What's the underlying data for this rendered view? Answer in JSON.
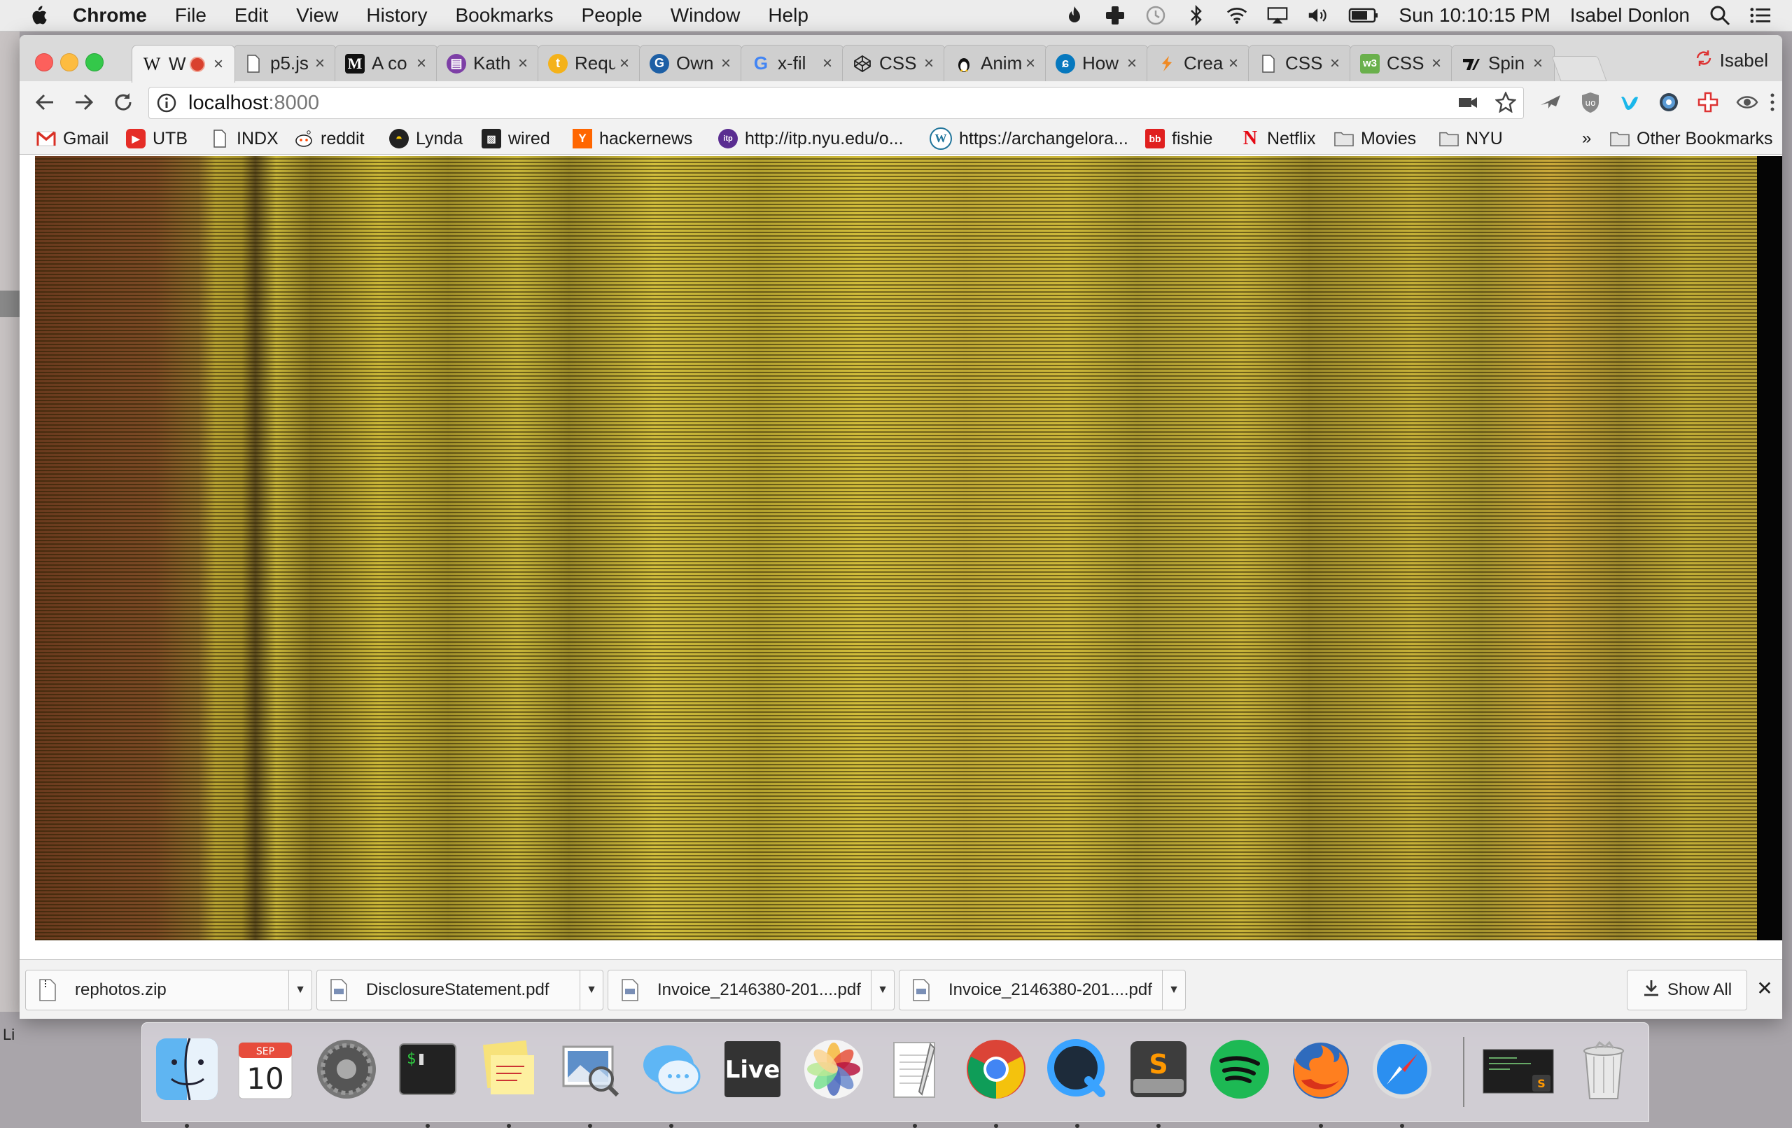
{
  "menubar": {
    "app": "Chrome",
    "items": [
      "File",
      "Edit",
      "View",
      "History",
      "Bookmarks",
      "People",
      "Window",
      "Help"
    ],
    "clock": "Sun 10:10:15 PM",
    "user": "Isabel Donlon"
  },
  "desktop": {
    "label_fragment": "Li"
  },
  "tabs": [
    {
      "icon": "wikipedia-icon",
      "title": "W  s",
      "active": true
    },
    {
      "icon": "page-icon",
      "title": "p5.js"
    },
    {
      "icon": "medium-icon",
      "title": "A co"
    },
    {
      "icon": "kathy-icon",
      "title": "Kath"
    },
    {
      "icon": "request-icon",
      "title": "Requ"
    },
    {
      "icon": "own-icon",
      "title": "Own"
    },
    {
      "icon": "google-icon",
      "title": "x-fil"
    },
    {
      "icon": "codepen-icon",
      "title": "CSS"
    },
    {
      "icon": "linux-icon",
      "title": "Anim"
    },
    {
      "icon": "drupal-icon",
      "title": "How"
    },
    {
      "icon": "create-icon",
      "title": "Crea"
    },
    {
      "icon": "page-icon",
      "title": "CSS"
    },
    {
      "icon": "w3-icon",
      "title": "CSS"
    },
    {
      "icon": "spin-icon",
      "title": "Spin"
    }
  ],
  "profile": {
    "name": "Isabel"
  },
  "omnibox": {
    "host": "localhost",
    "port": ":8000"
  },
  "bookmarks": [
    {
      "icon": "gmail-icon",
      "label": "Gmail"
    },
    {
      "icon": "youtube-icon",
      "label": "UTB"
    },
    {
      "icon": "page-icon",
      "label": "INDX"
    },
    {
      "icon": "reddit-icon",
      "label": "reddit"
    },
    {
      "icon": "lynda-icon",
      "label": "Lynda"
    },
    {
      "icon": "wired-icon",
      "label": "wired"
    },
    {
      "icon": "hackernews-icon",
      "label": "hackernews"
    },
    {
      "icon": "itp-icon",
      "label": "http://itp.nyu.edu/o..."
    },
    {
      "icon": "wordpress-icon",
      "label": "https://archangelora..."
    },
    {
      "icon": "fishie-icon",
      "label": "fishie"
    },
    {
      "icon": "netflix-icon",
      "label": "Netflix"
    },
    {
      "icon": "folder-icon",
      "label": "Movies"
    },
    {
      "icon": "folder-icon",
      "label": "NYU"
    }
  ],
  "bookmarks_overflow": "»",
  "other_bookmarks": "Other Bookmarks",
  "downloads": [
    {
      "name": "rephotos.zip",
      "icon": "zip-file-icon"
    },
    {
      "name": "DisclosureStatement.pdf",
      "icon": "pdf-file-icon"
    },
    {
      "name": "Invoice_2146380-201....pdf",
      "icon": "pdf-file-icon"
    },
    {
      "name": "Invoice_2146380-201....pdf",
      "icon": "pdf-file-icon"
    }
  ],
  "show_all": "Show All",
  "calendar": {
    "month": "SEP",
    "day": "10"
  },
  "dock": {
    "live_label": "Live",
    "apps": [
      "finder",
      "calendar",
      "system-preferences",
      "terminal",
      "stickies",
      "preview",
      "messages",
      "live",
      "photos",
      "textedit",
      "chrome",
      "quicktime",
      "sublime-text",
      "spotify",
      "firefox",
      "safari",
      "terminal-window",
      "trash"
    ]
  }
}
